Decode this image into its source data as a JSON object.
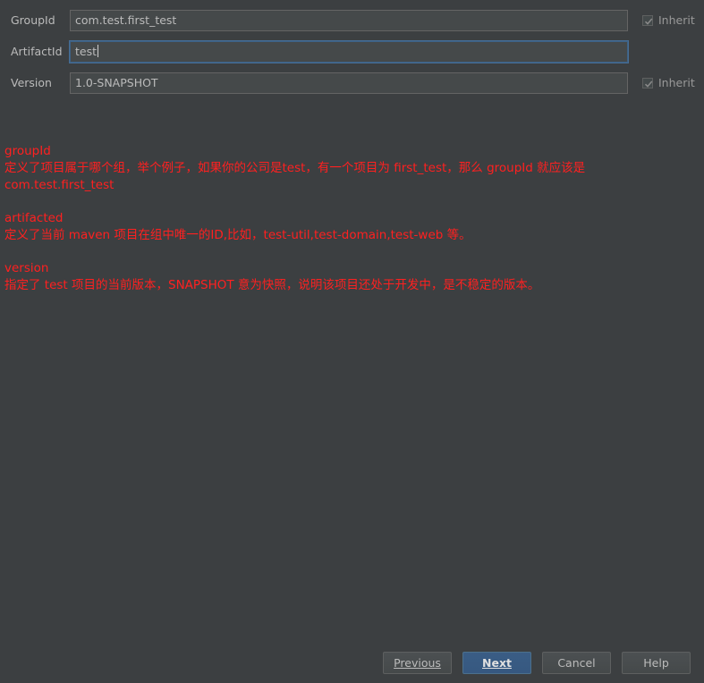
{
  "form": {
    "group_id": {
      "label": "GroupId",
      "value": "com.test.first_test",
      "inherit_label": "Inherit",
      "inherit_checked": true
    },
    "artifact_id": {
      "label": "ArtifactId",
      "value": "test"
    },
    "version": {
      "label": "Version",
      "value": "1.0-SNAPSHOT",
      "inherit_label": "Inherit",
      "inherit_checked": true
    }
  },
  "notes": {
    "group_heading": "groupId",
    "group_line1": "定义了项目属于哪个组，举个例子，如果你的公司是test，有一个项目为 first_test，那么 groupId 就应该是",
    "group_line2": "com.test.first_test",
    "artifact_heading": "artifacted",
    "artifact_line1": "定义了当前 maven 项目在组中唯一的ID,比如，test-util,test-domain,test-web 等。",
    "version_heading": "version",
    "version_line1": "指定了 test 项目的当前版本，SNAPSHOT 意为快照，说明该项目还处于开发中，是不稳定的版本。"
  },
  "buttons": {
    "previous": "Previous",
    "next": "Next",
    "cancel": "Cancel",
    "help": "Help"
  },
  "colors": {
    "background": "#3c3f41",
    "annotation_text": "#ff2020",
    "primary_button": "#365880",
    "focus_border": "#466d94"
  }
}
